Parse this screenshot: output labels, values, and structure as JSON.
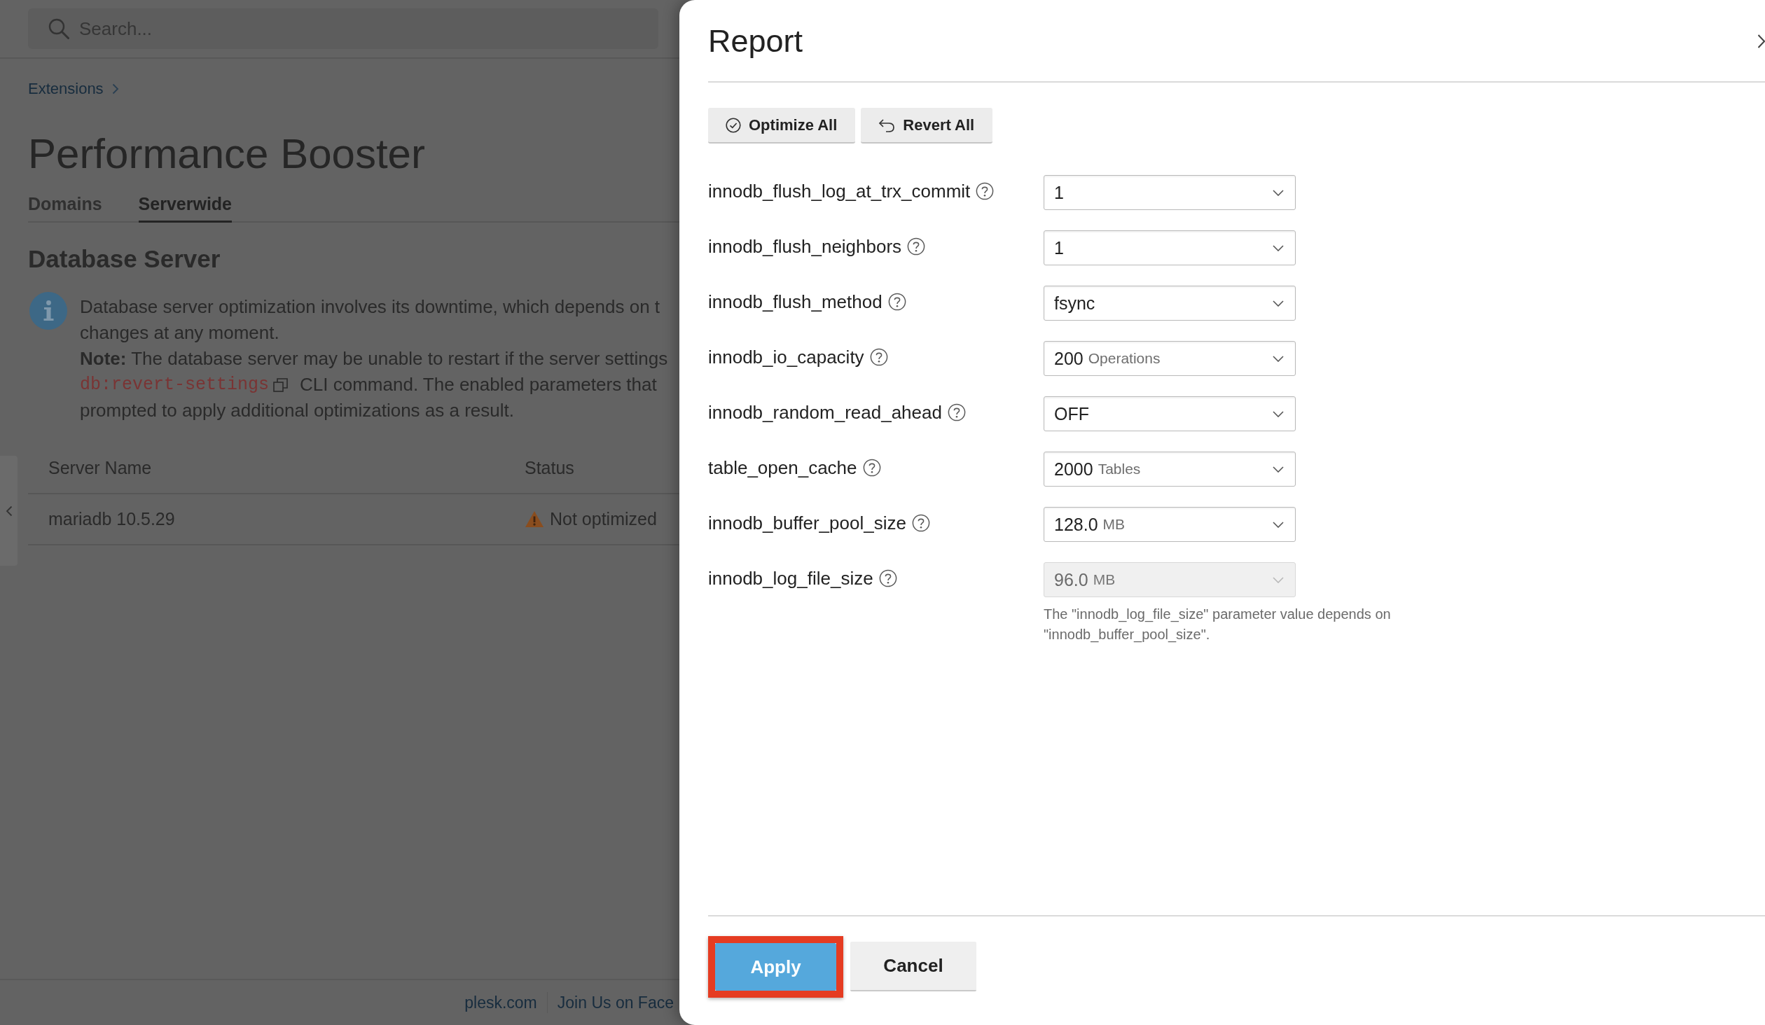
{
  "search": {
    "placeholder": "Search..."
  },
  "breadcrumb": [
    {
      "label": "Extensions"
    }
  ],
  "page_title": "Performance Booster",
  "tabs": [
    {
      "label": "Domains",
      "selected": false
    },
    {
      "label": "Serverwide",
      "selected": true
    }
  ],
  "section_title": "Database Server",
  "info": {
    "lines": [
      {
        "kind": "text",
        "text": "Database server optimization involves its downtime, which depends on t"
      },
      {
        "kind": "text",
        "text": "changes at any moment."
      },
      {
        "kind": "text",
        "text": "**Note:** The database server may be unable to restart if the server settings"
      },
      {
        "kind": "code",
        "code": "db:revert-settings",
        "text": "CLI command. The enabled parameters that"
      },
      {
        "kind": "text",
        "text": "prompted to apply additional optimizations as a result."
      }
    ]
  },
  "table": {
    "columns": [
      "Server Name",
      "Status"
    ],
    "rows": [
      {
        "name": "mariadb 10.5.29",
        "status": {
          "kind": "warning",
          "label": "Not optimized"
        }
      }
    ]
  },
  "footer_links": [
    "plesk.com",
    "Join Us on Face"
  ],
  "dialog": {
    "title": "Report",
    "actions": [
      {
        "kind": "optimize",
        "label": "Optimize All"
      },
      {
        "kind": "revert",
        "label": "Revert All"
      }
    ],
    "settings": [
      {
        "name": "innodb_flush_log_at_trx_commit",
        "value": "1",
        "disabled": false
      },
      {
        "name": "innodb_flush_neighbors",
        "value": "1",
        "disabled": false
      },
      {
        "name": "innodb_flush_method",
        "value": "fsync",
        "disabled": false
      },
      {
        "name": "innodb_io_capacity",
        "value": "200",
        "unit": "Operations",
        "disabled": false
      },
      {
        "name": "innodb_random_read_ahead",
        "value": "OFF",
        "disabled": false
      },
      {
        "name": "table_open_cache",
        "value": "2000",
        "unit": "Tables",
        "disabled": false
      },
      {
        "name": "innodb_buffer_pool_size",
        "value": "128.0",
        "unit": "MB",
        "disabled": false
      },
      {
        "name": "innodb_log_file_size",
        "value": "96.0",
        "unit": "MB",
        "disabled": true,
        "hint": "The \"innodb_log_file_size\" parameter value depends on \"innodb_buffer_pool_size\"."
      }
    ],
    "buttons": [
      {
        "kind": "apply",
        "label": "Apply",
        "highlighted": true
      },
      {
        "kind": "cancel",
        "label": "Cancel",
        "highlighted": false
      }
    ]
  }
}
